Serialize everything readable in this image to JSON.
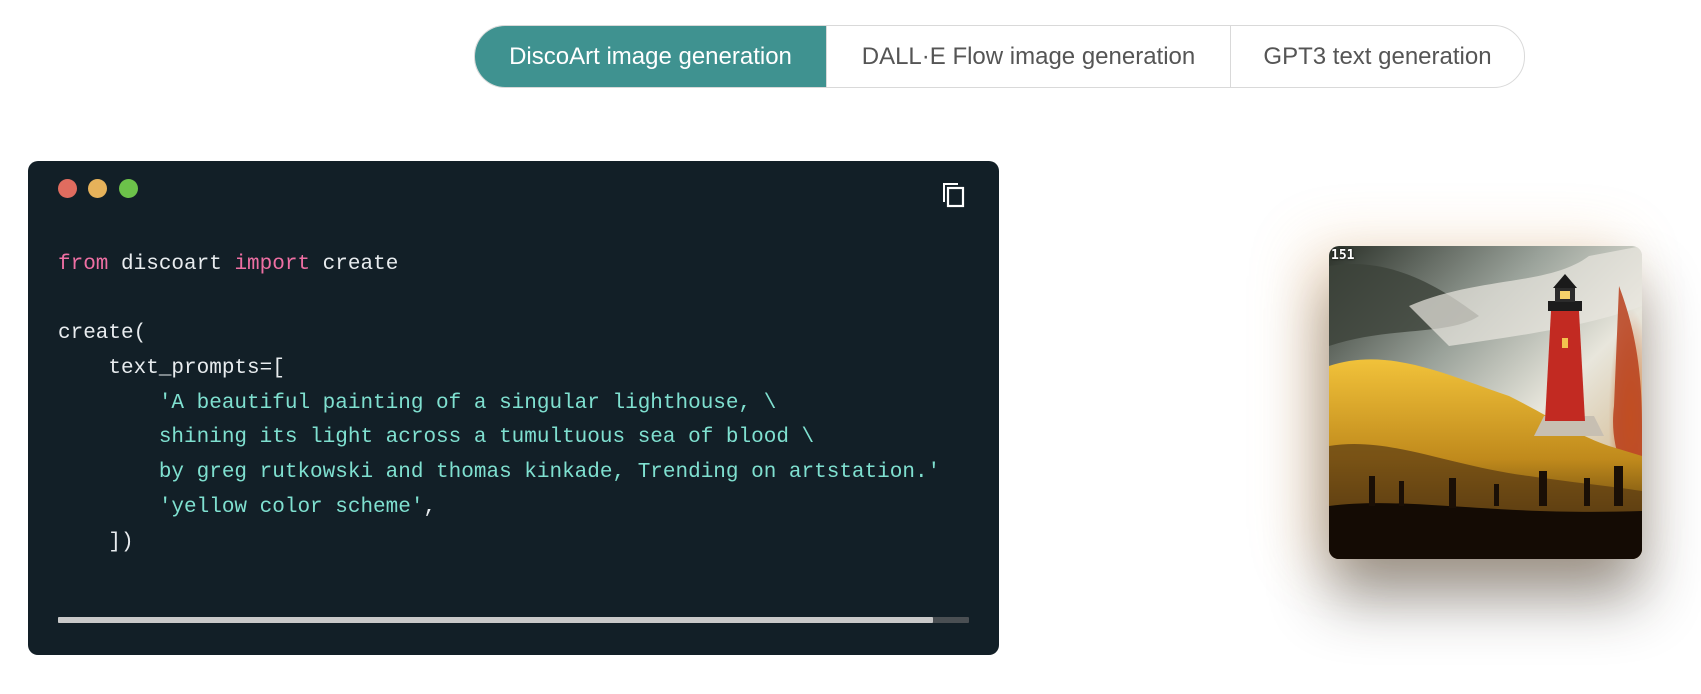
{
  "tabs": [
    {
      "label": "DiscoArt image generation",
      "active": true
    },
    {
      "label": "DALL·E Flow image generation",
      "active": false
    },
    {
      "label": "GPT3 text generation",
      "active": false
    }
  ],
  "code": {
    "lines": [
      [
        {
          "t": "from",
          "c": "kw"
        },
        {
          "t": " discoart ",
          "c": ""
        },
        {
          "t": "import",
          "c": "kw"
        },
        {
          "t": " create",
          "c": ""
        }
      ],
      [],
      [
        {
          "t": "create(",
          "c": ""
        }
      ],
      [
        {
          "t": "    text_prompts=[",
          "c": ""
        }
      ],
      [
        {
          "t": "        'A beautiful painting of a singular lighthouse, \\",
          "c": "str"
        }
      ],
      [
        {
          "t": "        shining its light across a tumultuous sea of blood \\",
          "c": "str"
        }
      ],
      [
        {
          "t": "        by greg rutkowski and thomas kinkade, Trending on artstation.'",
          "c": "str"
        }
      ],
      [
        {
          "t": "        'yellow color scheme'",
          "c": "str"
        },
        {
          "t": ",",
          "c": ""
        }
      ],
      [
        {
          "t": "    ])",
          "c": ""
        }
      ]
    ],
    "copy_icon": "copy-icon",
    "scroll_fraction_visible": 0.96
  },
  "output": {
    "step_label": "151",
    "image_subject": "lighthouse-painting"
  },
  "colors": {
    "accent": "#3f9290",
    "code_bg": "#121f27",
    "keyword": "#ee6fa3",
    "string": "#7fe0d0"
  }
}
